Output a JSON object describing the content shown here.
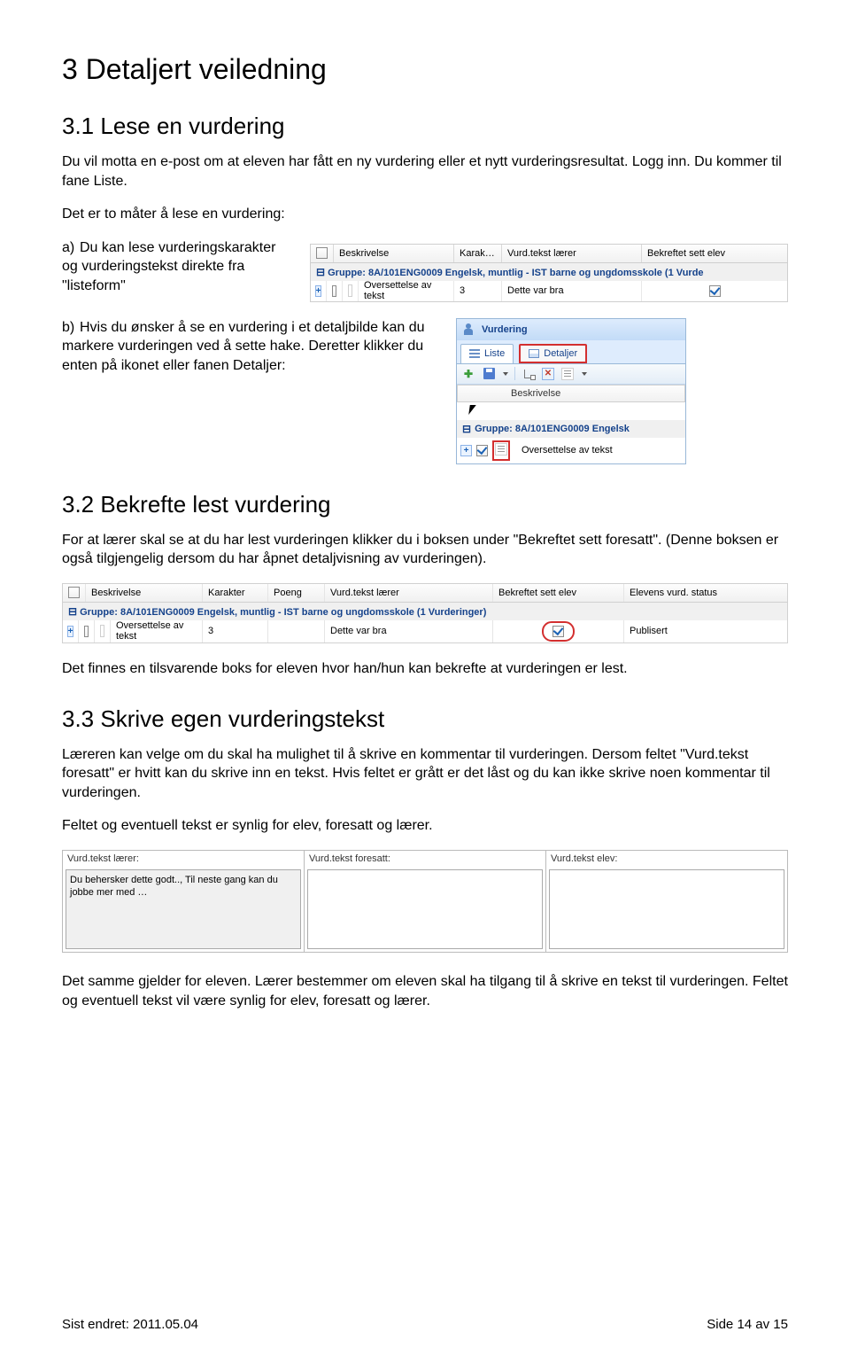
{
  "h1": "3 Detaljert veiledning",
  "s31": {
    "title": "3.1 Lese en vurdering",
    "intro": "Du vil motta en e-post om at eleven har fått en ny vurdering eller et nytt vurderingsresultat. Logg inn. Du kommer til fane Liste.",
    "lead": "Det er to måter å lese en vurdering:",
    "a_lbl": "a)",
    "a_text": "Du kan lese vurderingskarakter og vurderingstekst direkte fra \"listeform\"",
    "b_lbl": "b)",
    "b_text": "Hvis du ønsker å se en vurdering i et detaljbilde kan du markere vurderingen ved å sette hake. Deretter klikker du enten på ikonet eller fanen Detaljer:"
  },
  "ss1": {
    "cols": [
      "Beskrivelse",
      "Karak…",
      "Vurd.tekst lærer",
      "Bekreftet sett elev"
    ],
    "group": "Gruppe: 8A/101ENG0009 Engelsk, muntlig - IST barne og ungdomsskole (1 Vurde",
    "row": {
      "beskrivelse": "Oversettelse av tekst",
      "karakter": "3",
      "tekst": "Dette var bra"
    }
  },
  "ss2": {
    "title": "Vurdering",
    "tab1": "Liste",
    "tab2": "Detaljer",
    "col": "Beskrivelse",
    "group": "Gruppe: 8A/101ENG0009 Engelsk",
    "row": "Oversettelse av tekst"
  },
  "s32": {
    "title": "3.2 Bekrefte lest vurdering",
    "p1": "For at lærer skal se at du har lest vurderingen klikker du i boksen under \"Bekreftet sett foresatt\". (Denne boksen er også tilgjengelig dersom du har åpnet detaljvisning av vurderingen).",
    "p2": "Det finnes en tilsvarende boks for eleven hvor han/hun kan bekrefte at vurderingen er lest."
  },
  "ss3": {
    "cols": [
      "Beskrivelse",
      "Karakter",
      "Poeng",
      "Vurd.tekst lærer",
      "Bekreftet sett elev",
      "Elevens vurd. status"
    ],
    "group": "Gruppe: 8A/101ENG0009 Engelsk, muntlig - IST barne og ungdomsskole (1 Vurderinger)",
    "row": {
      "beskrivelse": "Oversettelse av tekst",
      "karakter": "3",
      "poeng": "",
      "tekst": "Dette var bra",
      "status": "Publisert"
    }
  },
  "s33": {
    "title": "3.3 Skrive egen vurderingstekst",
    "p1": "Læreren kan velge om du skal ha mulighet til å skrive en kommentar til vurderingen. Dersom feltet \"Vurd.tekst foresatt\" er hvitt kan du skrive inn en tekst. Hvis feltet er grått er det låst og du kan ikke skrive noen kommentar til vurderingen.",
    "p2": "Feltet og eventuell tekst er synlig for elev, foresatt og lærer.",
    "p3": "Det samme gjelder for eleven. Lærer bestemmer om eleven skal ha tilgang til å skrive en tekst til vurderingen. Feltet og eventuell tekst vil være synlig for elev, foresatt og lærer."
  },
  "tf": {
    "l1": "Vurd.tekst lærer:",
    "v1": "Du behersker dette godt.., Til neste gang kan du jobbe mer med …",
    "l2": "Vurd.tekst foresatt:",
    "l3": "Vurd.tekst elev:"
  },
  "footer": {
    "left": "Sist endret: 2011.05.04",
    "right": "Side 14 av 15"
  }
}
